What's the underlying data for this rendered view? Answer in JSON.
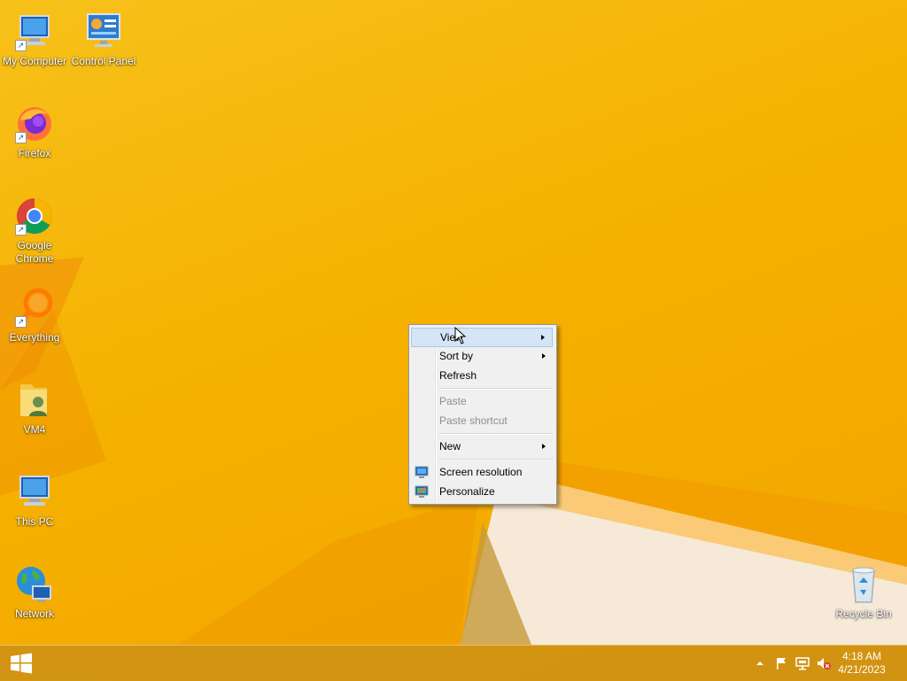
{
  "desktop": {
    "icons": [
      {
        "label": "My Computer",
        "icon": "computer-icon"
      },
      {
        "label": "Control Panel",
        "icon": "control-panel-icon"
      },
      {
        "label": "Firefox",
        "icon": "firefox-icon"
      },
      {
        "label": "Google Chrome",
        "icon": "chrome-icon"
      },
      {
        "label": "Everything",
        "icon": "search-magnifier-icon"
      },
      {
        "label": "VM4",
        "icon": "user-folder-icon"
      },
      {
        "label": "This PC",
        "icon": "computer-icon"
      },
      {
        "label": "Network",
        "icon": "network-globe-icon"
      },
      {
        "label": "Recycle Bin",
        "icon": "recycle-bin-icon"
      }
    ]
  },
  "context_menu": {
    "items": [
      {
        "label": "View",
        "submenu": true,
        "state": "hover"
      },
      {
        "label": "Sort by",
        "submenu": true
      },
      {
        "label": "Refresh"
      },
      {
        "label": "Paste",
        "disabled": true
      },
      {
        "label": "Paste shortcut",
        "disabled": true
      },
      {
        "label": "New",
        "submenu": true
      },
      {
        "label": "Screen resolution",
        "icon": "monitor-icon"
      },
      {
        "label": "Personalize",
        "icon": "personalize-icon"
      }
    ]
  },
  "taskbar": {
    "start_icon": "windows-logo-icon",
    "tray_icons": [
      "show-hidden-icons-chevron",
      "action-center-flag-icon",
      "network-icon",
      "volume-muted-icon"
    ],
    "time": "4:18 AM",
    "date": "4/21/2023"
  },
  "colors": {
    "wallpaper": "#f5b100",
    "menu_bg": "#f0f0f0",
    "menu_hover": "#d5e5f7",
    "taskbar": "#cd9114"
  }
}
